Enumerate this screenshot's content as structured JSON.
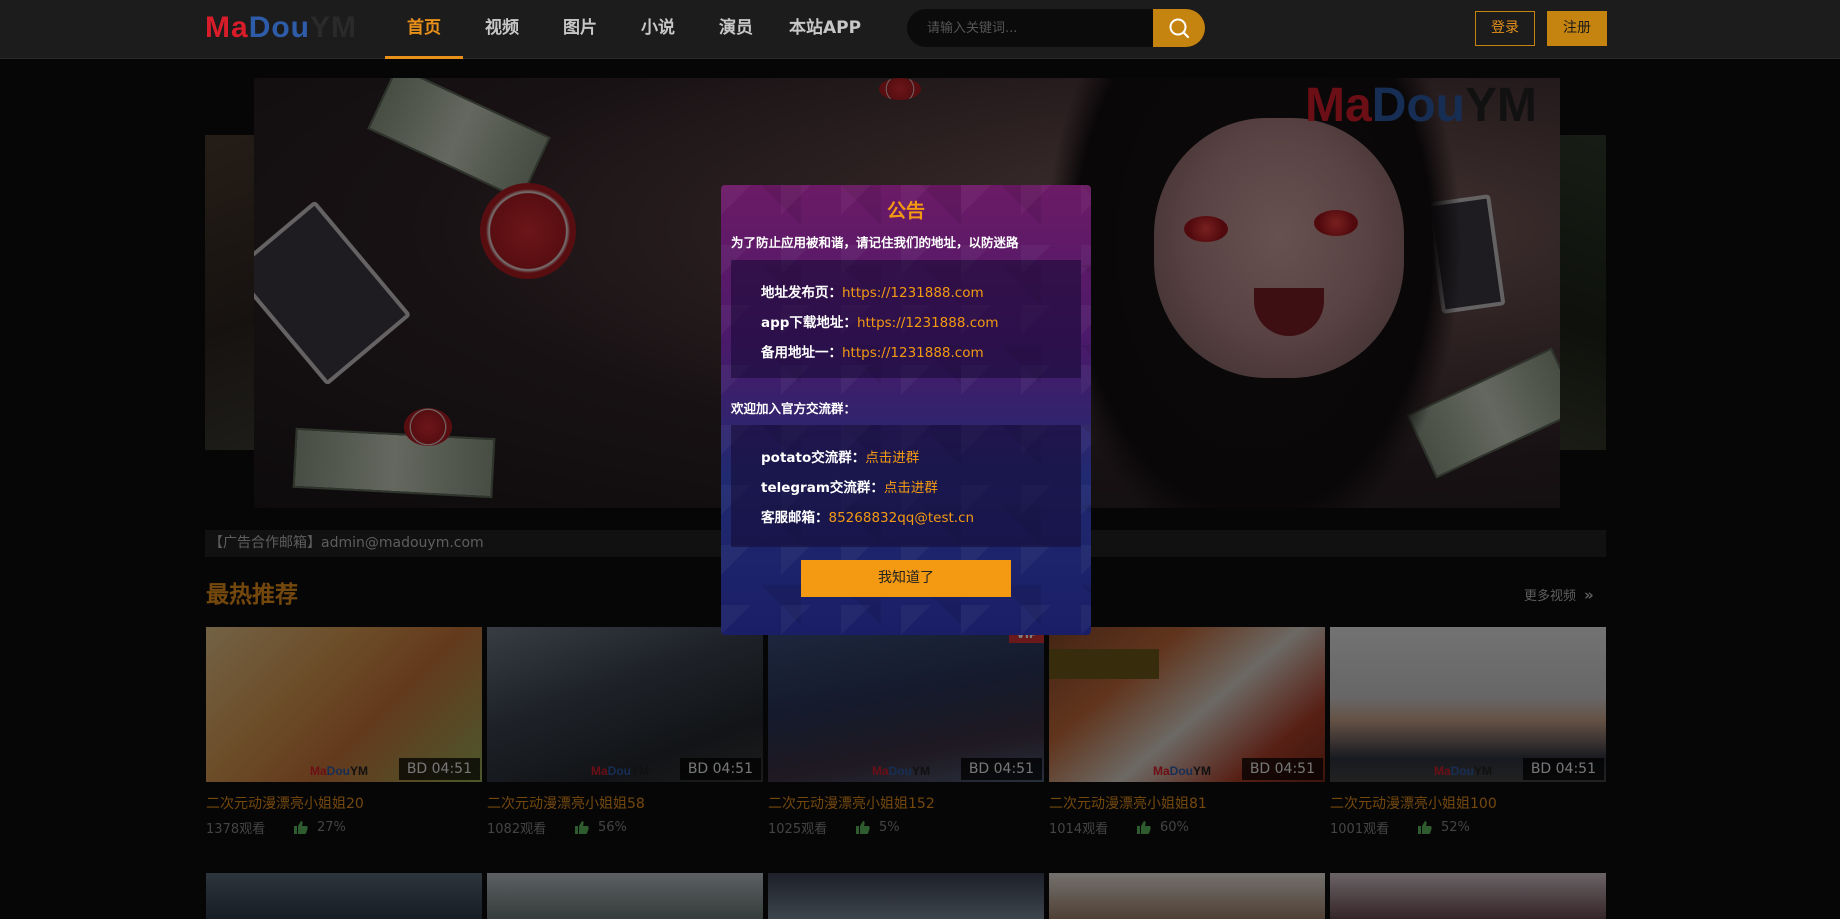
{
  "header": {
    "logo": {
      "m": "M",
      "a": "a",
      "d": "Dou",
      "y": "YM"
    },
    "nav": [
      {
        "label": "首页",
        "active": true
      },
      {
        "label": "视频",
        "active": false
      },
      {
        "label": "图片",
        "active": false
      },
      {
        "label": "小说",
        "active": false
      },
      {
        "label": "演员",
        "active": false
      },
      {
        "label": "本站APP",
        "active": false
      }
    ],
    "search_placeholder": "请输入关键词...",
    "login_label": "登录",
    "register_label": "注册"
  },
  "banner": {
    "logo": {
      "m": "Ma",
      "d": "Dou",
      "y": "YM"
    }
  },
  "ad_bar": "【广告合作邮箱】admin@madouym.com",
  "section": {
    "title": "最热推荐",
    "more_label": "更多视频"
  },
  "videos": [
    {
      "title": "二次元动漫漂亮小姐姐20",
      "duration": "BD 04:51",
      "views": "1378观看",
      "rating": "27%",
      "vip": ""
    },
    {
      "title": "二次元动漫漂亮小姐姐58",
      "duration": "BD 04:51",
      "views": "1082观看",
      "rating": "56%",
      "vip": ""
    },
    {
      "title": "二次元动漫漂亮小姐姐152",
      "duration": "BD 04:51",
      "views": "1025观看",
      "rating": "5%",
      "vip": "VIP"
    },
    {
      "title": "二次元动漫漂亮小姐姐81",
      "duration": "BD 04:51",
      "views": "1014观看",
      "rating": "60%",
      "vip": ""
    },
    {
      "title": "二次元动漫漂亮小姐姐100",
      "duration": "BD 04:51",
      "views": "1001观看",
      "rating": "52%",
      "vip": ""
    }
  ],
  "thumb_logo": {
    "m": "Ma",
    "d": "Dou",
    "y": "YM"
  },
  "modal": {
    "title": "公告",
    "subtitle": "为了防止应用被和谐，请记住我们的地址，以防迷路",
    "addresses": [
      {
        "label": "地址发布页：",
        "value": "https://1231888.com"
      },
      {
        "label": "app下载地址：",
        "value": "https://1231888.com"
      },
      {
        "label": "备用地址一：",
        "value": "https://1231888.com"
      }
    ],
    "groups_heading": "欢迎加入官方交流群：",
    "groups": [
      {
        "label": "potato交流群：",
        "value": "点击进群"
      },
      {
        "label": "telegram交流群：",
        "value": "点击进群"
      },
      {
        "label": "客服邮箱：",
        "value": "85268832qq@test.cn"
      }
    ],
    "ok_label": "我知道了"
  },
  "colors": {
    "accent": "#e8901a",
    "modal_top": "#6c1a66",
    "modal_bottom": "#1a1e66",
    "vip": "#d33232"
  }
}
